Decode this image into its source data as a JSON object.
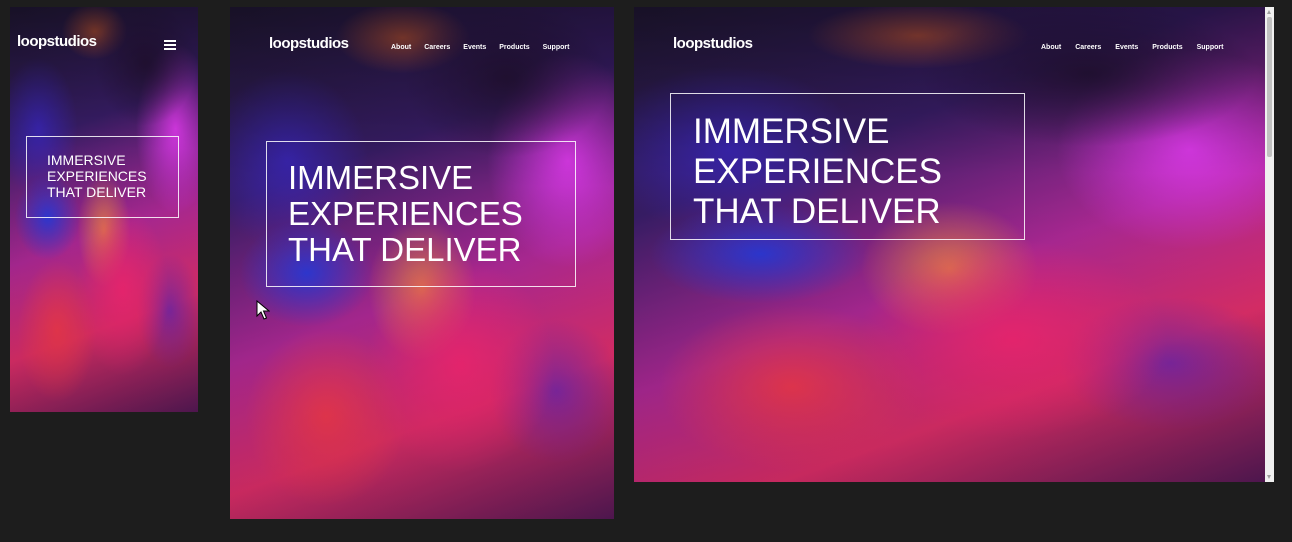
{
  "brand": "loopstudios",
  "nav": [
    "About",
    "Careers",
    "Events",
    "Products",
    "Support"
  ],
  "hero_lines": [
    "IMMERSIVE",
    "EXPERIENCES",
    "THAT DELIVER"
  ],
  "icons": {
    "menu": "hamburger-menu-icon",
    "cursor": "mouse-pointer-icon"
  },
  "colors": {
    "page_background": "#1d1d1d",
    "text": "#ffffff",
    "border": "#ffffff"
  }
}
